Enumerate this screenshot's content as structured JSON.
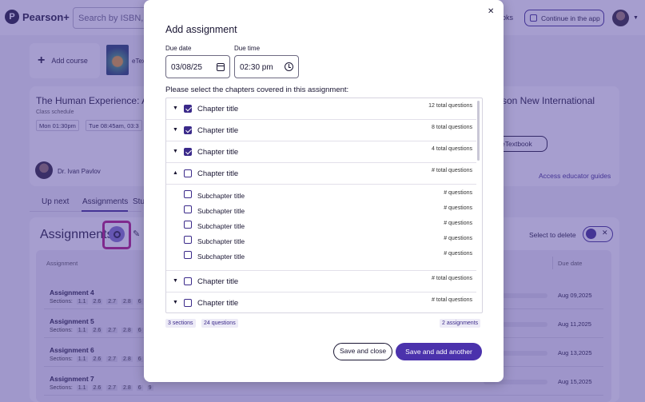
{
  "app": {
    "brand": "Pearson+",
    "search_placeholder": "Search by ISBN, Title",
    "books_label": "oks",
    "continue_label": "Continue in the app"
  },
  "courses": {
    "add_label": "Add course",
    "book_label": "eTex"
  },
  "course": {
    "title": "The Human Experience: An",
    "schedule_label": "Class schedule",
    "schedule": [
      "Mon  01:30pm",
      "Tue  08:45am, 03:3"
    ],
    "professor": "Dr. Ivan Pavlov",
    "right_title": "rson New International",
    "etext_label": "eTextbook",
    "access_link": "Access educator guides"
  },
  "tabs": [
    "Up next",
    "Assignments",
    "Stu"
  ],
  "assignments": {
    "title": "Assignments",
    "select_delete": "Select to delete",
    "col_assignment": "Assignment",
    "col_due": "Due date",
    "sections_label": "Sections:",
    "rows": [
      {
        "name": "Assignment 4",
        "sections": [
          "1.1",
          "2.6",
          "2.7",
          "2.8",
          "6"
        ],
        "due": "Aug 09,2025"
      },
      {
        "name": "Assignment 5",
        "sections": [
          "1.1",
          "2.6",
          "2.7",
          "2.8",
          "6"
        ],
        "due": "Aug 11,2025"
      },
      {
        "name": "Assignment 6",
        "sections": [
          "1.1",
          "2.6",
          "2.7",
          "2.8",
          "6"
        ],
        "due": "Aug 13,2025"
      },
      {
        "name": "Assignment 7",
        "sections": [
          "1.1",
          "2.6",
          "2.7",
          "2.8",
          "6",
          "9"
        ],
        "due": "Aug 15,2025"
      }
    ]
  },
  "modal": {
    "title": "Add assignment",
    "due_date_label": "Due date",
    "due_date_value": "03/08/25",
    "due_time_label": "Due time",
    "due_time_value": "02:30 pm",
    "instructions": "Please select the chapters covered in this assignment:",
    "items": [
      {
        "kind": "chapter",
        "label": "Chapter title",
        "count": "12 total questions",
        "checked": true,
        "expanded": false
      },
      {
        "kind": "chapter",
        "label": "Chapter title",
        "count": "8 total questions",
        "checked": true,
        "expanded": false
      },
      {
        "kind": "chapter",
        "label": "Chapter title",
        "count": "4 total questions",
        "checked": true,
        "expanded": false
      },
      {
        "kind": "chapter",
        "label": "Chapter title",
        "count": "# total questions",
        "checked": false,
        "expanded": true
      },
      {
        "kind": "sub",
        "label": "Subchapter title",
        "count": "# questions",
        "checked": false
      },
      {
        "kind": "sub",
        "label": "Subchapter title",
        "count": "# questions",
        "checked": false
      },
      {
        "kind": "sub",
        "label": "Subchapter title",
        "count": "# questions",
        "checked": false
      },
      {
        "kind": "sub",
        "label": "Subchapter title",
        "count": "# questions",
        "checked": false
      },
      {
        "kind": "sub",
        "label": "Subchapter title",
        "count": "# questions",
        "checked": false
      },
      {
        "kind": "chapter",
        "label": "Chapter title",
        "count": "# total questions",
        "checked": false,
        "expanded": false
      },
      {
        "kind": "chapter",
        "label": "Chapter title",
        "count": "# total questions",
        "checked": false,
        "expanded": false
      }
    ],
    "summary_sections": "3 sections",
    "summary_questions": "24 questions",
    "summary_assignments": "2 assignments",
    "save_close_label": "Save and close",
    "save_add_label": "Save and add another"
  },
  "colors": {
    "overlay": "#4d3ea0",
    "primary": "#4b32ac",
    "highlight": "#b0157a"
  }
}
